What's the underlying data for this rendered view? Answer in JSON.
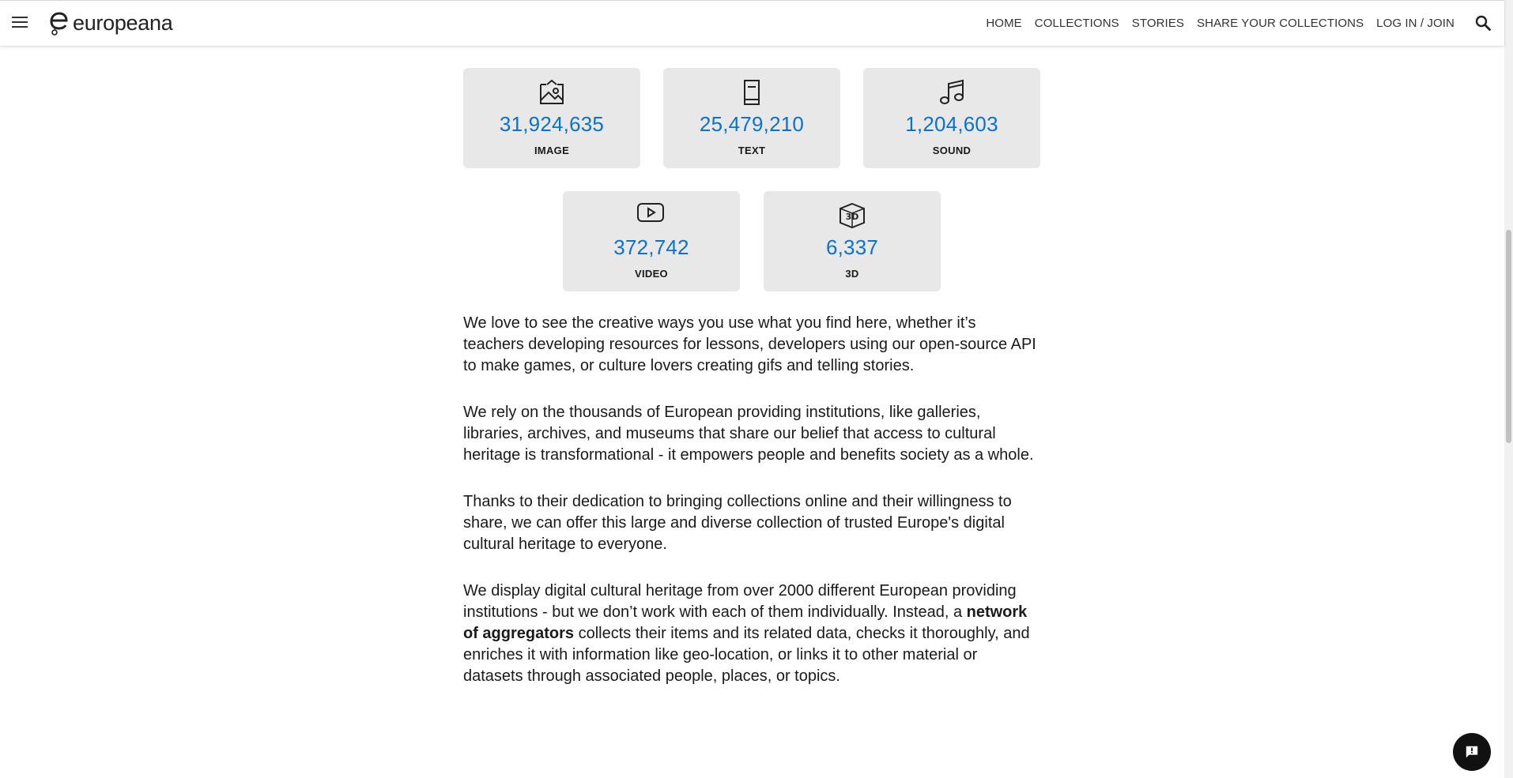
{
  "header": {
    "logo_text": "europeana",
    "nav": [
      "HOME",
      "COLLECTIONS",
      "STORIES",
      "SHARE YOUR COLLECTIONS",
      "LOG IN / JOIN"
    ]
  },
  "stats": [
    {
      "count": "31,924,635",
      "label": "IMAGE",
      "icon": "image-icon"
    },
    {
      "count": "25,479,210",
      "label": "TEXT",
      "icon": "book-icon"
    },
    {
      "count": "1,204,603",
      "label": "SOUND",
      "icon": "music-note-icon"
    },
    {
      "count": "372,742",
      "label": "VIDEO",
      "icon": "video-play-icon"
    },
    {
      "count": "6,337",
      "label": "3D",
      "icon": "3d-icon"
    }
  ],
  "paragraphs": {
    "p1": "We love to see the creative ways you use what you find here, whether it’s teachers developing resources for lessons, developers using our open-source API to make games, or culture lovers creating gifs and telling stories.",
    "p2": "We rely on the thousands of European providing institutions, like galleries, libraries, archives, and museums that share our belief that access to cultural heritage is transformational - it empowers people and benefits society as a whole.",
    "p3": "Thanks to their dedication to bringing collections online and their willingness to share, we can offer this large and diverse collection of trusted Europe's digital cultural heritage to everyone.",
    "p4_before": "We display digital cultural heritage from over 2000 different European providing institutions - but we don’t work with each of them individually. Instead, a ",
    "p4_bold": "network of aggregators",
    "p4_after": " collects their items and its related data, checks it thoroughly, and enriches it with information like geo-location, or links it to other material or datasets through associated people, places, or topics."
  },
  "colors": {
    "count_blue": "#0a72cc",
    "card_bg": "#e8e8e8"
  }
}
